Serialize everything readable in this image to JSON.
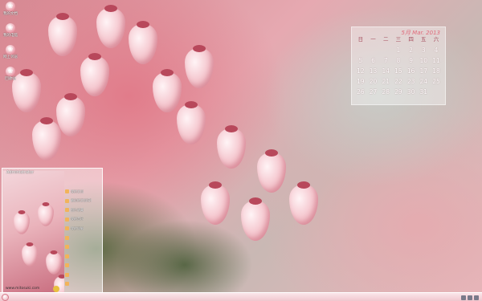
{
  "desktop": {
    "icons": [
      {
        "label": "我的文档",
        "glyph": "❀"
      },
      {
        "label": "我的电脑",
        "glyph": "❀"
      },
      {
        "label": "网上邻居",
        "glyph": "❀"
      },
      {
        "label": "回收站",
        "glyph": "❀"
      }
    ]
  },
  "calendar": {
    "title": "5月 Mar. 2013",
    "weekdays": [
      "日",
      "一",
      "二",
      "三",
      "四",
      "五",
      "六"
    ],
    "weeks": [
      [
        {
          "d": ""
        },
        {
          "d": ""
        },
        {
          "d": ""
        },
        {
          "d": "1"
        },
        {
          "d": "2"
        },
        {
          "d": "3"
        },
        {
          "d": "4"
        }
      ],
      [
        {
          "d": "5"
        },
        {
          "d": "6"
        },
        {
          "d": "7"
        },
        {
          "d": "8"
        },
        {
          "d": "9"
        },
        {
          "d": "10"
        },
        {
          "d": "11"
        }
      ],
      [
        {
          "d": "12"
        },
        {
          "d": "13"
        },
        {
          "d": "14"
        },
        {
          "d": "15"
        },
        {
          "d": "16"
        },
        {
          "d": "17"
        },
        {
          "d": "18"
        }
      ],
      [
        {
          "d": "19"
        },
        {
          "d": "20"
        },
        {
          "d": "21"
        },
        {
          "d": "22"
        },
        {
          "d": "23"
        },
        {
          "d": "24"
        },
        {
          "d": "25"
        }
      ],
      [
        {
          "d": "26"
        },
        {
          "d": "27"
        },
        {
          "d": "28"
        },
        {
          "d": "29"
        },
        {
          "d": "30"
        },
        {
          "d": "31"
        },
        {
          "d": ""
        }
      ]
    ]
  },
  "start_menu": {
    "user": "Administrator",
    "items": [
      "我的文档",
      "最近的文档(D)",
      "图片收藏",
      "我的音乐",
      "我的电脑",
      "",
      "",
      "",
      "",
      "",
      ""
    ],
    "url": "www.mitosuki.com"
  },
  "colors": {
    "accent": "#e06c7c",
    "taskbar": "#f0c3cb"
  }
}
